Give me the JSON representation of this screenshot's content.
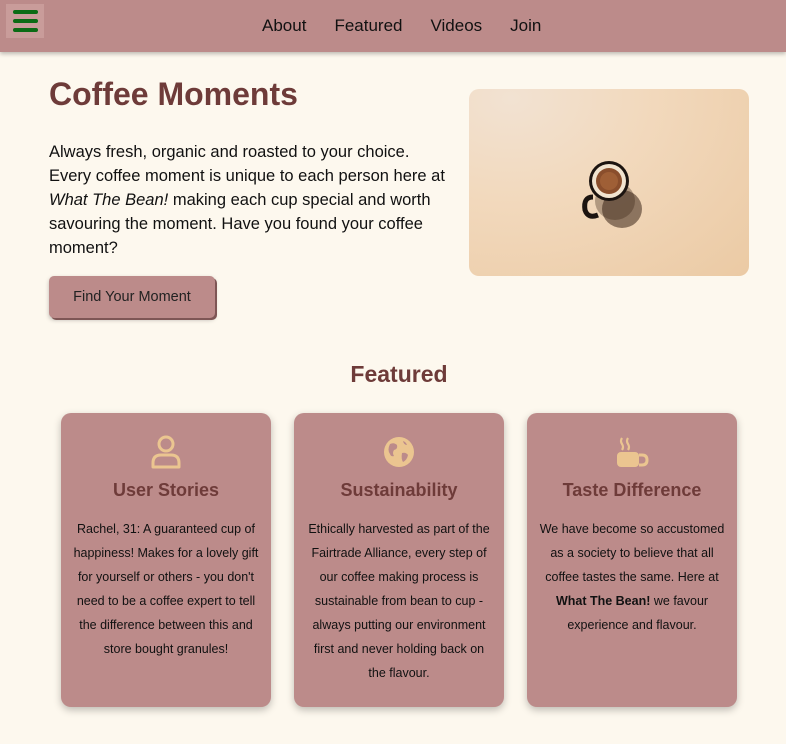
{
  "nav": {
    "items": [
      "About",
      "Featured",
      "Videos",
      "Join"
    ],
    "menu_icon": "hamburger-menu-icon",
    "menu_icon_color": "#0b6b14"
  },
  "hero": {
    "title": "Coffee Moments",
    "text_before": "Always fresh, organic and roasted to your choice. Every coffee moment is unique to each person here at ",
    "brand_italic": "What The Bean!",
    "text_after": " making each cup special and worth savouring the moment. Have you found your coffee moment?",
    "button_label": "Find Your Moment",
    "image": "coffee-cup-top-view-image"
  },
  "featured": {
    "title": "Featured",
    "cards": [
      {
        "icon": "user-icon",
        "title": "User Stories",
        "text": "Rachel, 31: A guaranteed cup of happiness! Makes for a lovely gift for yourself or others - you don't need to be a coffee expert to tell the difference between this and store bought granules!"
      },
      {
        "icon": "globe-icon",
        "title": "Sustainability",
        "text": "Ethically harvested as part of the Fairtrade Alliance, every step of our coffee making process is sustainable from bean to cup - always putting our environment first and never holding back on the flavour."
      },
      {
        "icon": "mug-hot-icon",
        "title": "Taste Difference",
        "text_before": "We have become so accustomed as a society to believe that all coffee tastes the same. Here at ",
        "text_bold": "What The Bean!",
        "text_after": " we favour experience and flavour."
      }
    ]
  },
  "colors": {
    "background": "#fdf8ee",
    "accent": "#bc8b8a",
    "heading": "#6e3b39",
    "icon": "#ebc590"
  }
}
